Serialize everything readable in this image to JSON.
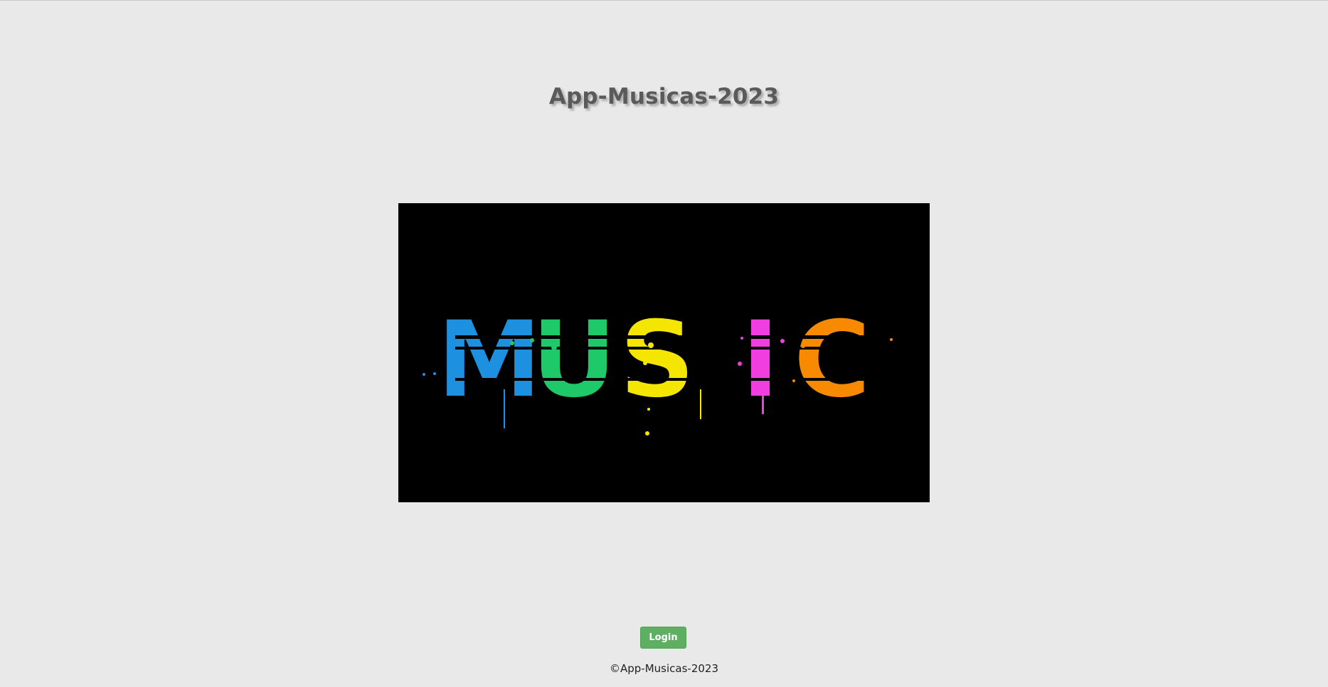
{
  "page": {
    "title": "App-Musicas-2023",
    "footer": "©App-Musicas-2023"
  },
  "hero": {
    "text": "MUSIC",
    "letters": [
      "M",
      "U",
      "S",
      "I",
      "C"
    ],
    "colors": [
      "#1e90e0",
      "#1ec96a",
      "#f5e600",
      "#f03ee0",
      "#f78a00"
    ],
    "background": "#000000"
  },
  "actions": {
    "login_label": "Login"
  },
  "colors": {
    "page_background": "#e9e9e9",
    "title_color": "#5a5a5a",
    "button_background": "#5faf63"
  }
}
